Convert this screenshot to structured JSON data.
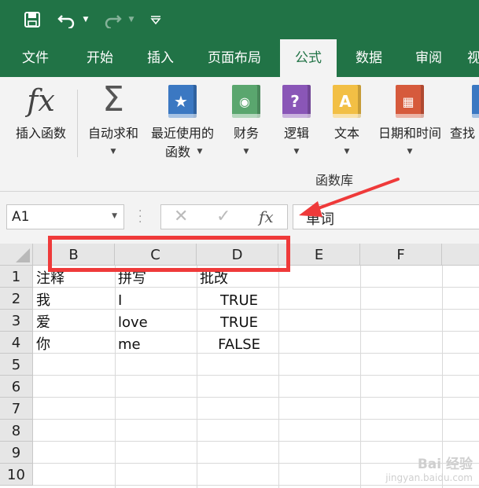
{
  "titlebar": {
    "background": "#217346"
  },
  "ribbon_tabs": [
    {
      "label": "文件"
    },
    {
      "label": "开始"
    },
    {
      "label": "插入"
    },
    {
      "label": "页面布局"
    },
    {
      "label": "公式",
      "active": true
    },
    {
      "label": "数据"
    },
    {
      "label": "审阅"
    },
    {
      "label": "视"
    }
  ],
  "ribbon": {
    "insert_function": "插入函数",
    "autosum": "自动求和",
    "recent_line1": "最近使用的",
    "recent_line2": "函数",
    "financial": "财务",
    "logical": "逻辑",
    "text": "文本",
    "datetime": "日期和时间",
    "lookup": "查找",
    "group_label": "函数库"
  },
  "formula_bar": {
    "name_box": "A1",
    "fx_glyph": "fx",
    "content": "单词"
  },
  "sheet": {
    "columns": [
      "B",
      "C",
      "D",
      "E",
      "F"
    ],
    "rows": [
      "1",
      "2",
      "3",
      "4",
      "5",
      "6",
      "7",
      "8",
      "9",
      "10"
    ],
    "cells": {
      "B1": "注释",
      "C1": "拼写",
      "D1": "批改",
      "B2": "我",
      "C2": "I",
      "D2": "TRUE",
      "B3": "爱",
      "C3": "love",
      "D3": "TRUE",
      "B4": "你",
      "C4": "me",
      "D4": "FALSE"
    }
  },
  "colors": {
    "excel_green": "#217346",
    "annotation_red": "#ef3a3a"
  },
  "watermark": {
    "line1": "Bai 经验",
    "line2": "jingyan.baidu.com"
  }
}
